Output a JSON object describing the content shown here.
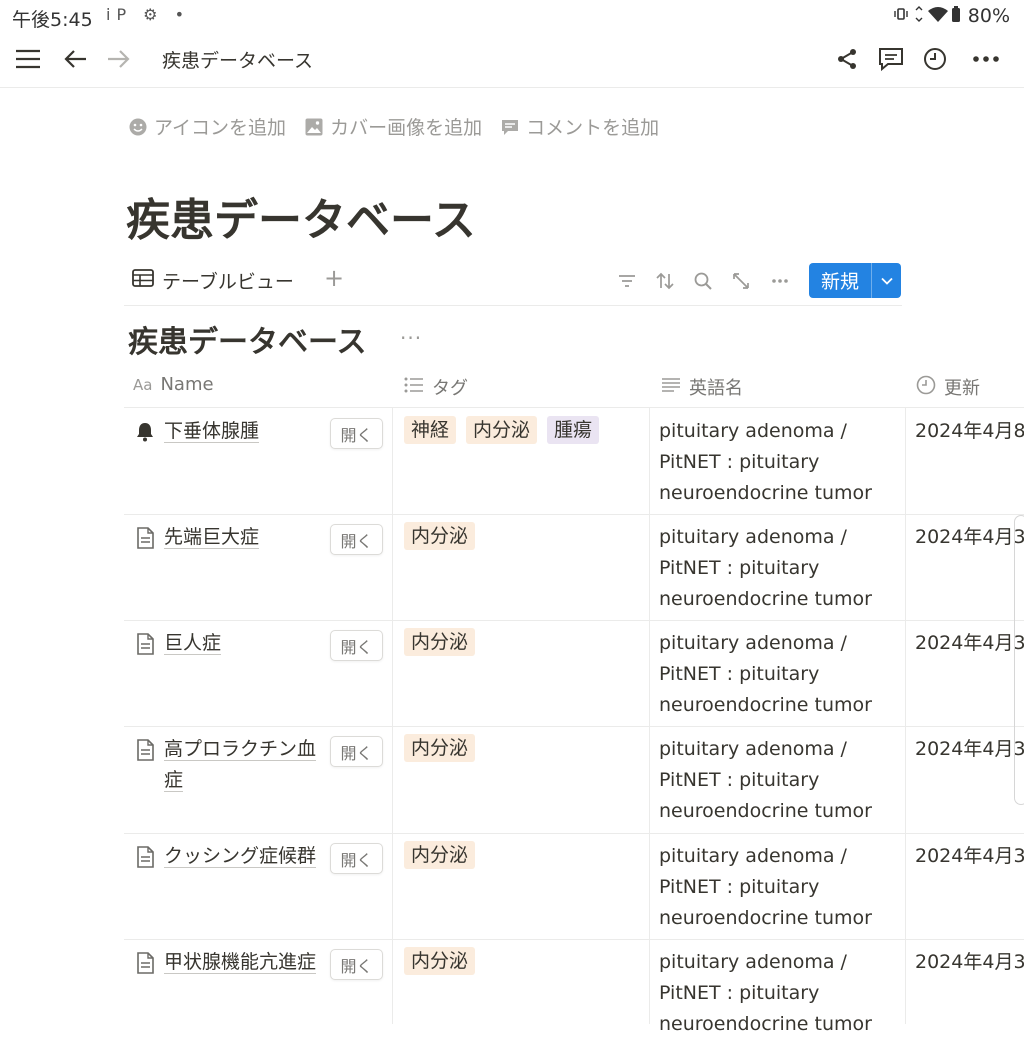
{
  "status_bar": {
    "time": "午後5:45",
    "notifications": "iP ⚙ •",
    "battery": "80%"
  },
  "top_bar": {
    "page_name": "疾患データベース"
  },
  "page_actions": {
    "add_icon": "アイコンを追加",
    "add_cover": "カバー画像を追加",
    "add_comment": "コメントを追加"
  },
  "page_title": "疾患データベース",
  "view_bar": {
    "tab_label": "テーブルビュー",
    "add_view": "+",
    "new_button": "新規"
  },
  "database": {
    "title": "疾患データベース",
    "more": "···",
    "columns": [
      {
        "label": "Name",
        "icon": "Aa"
      },
      {
        "label": "タグ",
        "icon": "list-icon"
      },
      {
        "label": "英語名",
        "icon": "text-icon"
      },
      {
        "label": "更新",
        "icon": "clock-icon"
      }
    ],
    "open_label": "開く",
    "rows": [
      {
        "icon": "bell-icon",
        "name": "下垂体腺腫",
        "tags": [
          "神経",
          "内分泌",
          "腫瘍"
        ],
        "english": "pituitary adenoma / PitNET : pituitary neuroendocrine tumor",
        "updated": "2024年4月8"
      },
      {
        "icon": "page-icon",
        "name": "先端巨大症",
        "tags": [
          "内分泌"
        ],
        "english": "pituitary adenoma / PitNET : pituitary neuroendocrine tumor",
        "updated": "2024年4月3"
      },
      {
        "icon": "page-icon",
        "name": "巨人症",
        "tags": [
          "内分泌"
        ],
        "english": "pituitary adenoma / PitNET : pituitary neuroendocrine tumor",
        "updated": "2024年4月3"
      },
      {
        "icon": "page-icon",
        "name": "高プロラクチン血症",
        "tags": [
          "内分泌"
        ],
        "english": "pituitary adenoma / PitNET : pituitary neuroendocrine tumor",
        "updated": "2024年4月3"
      },
      {
        "icon": "page-icon",
        "name": "クッシング症候群",
        "tags": [
          "内分泌"
        ],
        "english": "pituitary adenoma / PitNET : pituitary neuroendocrine tumor",
        "updated": "2024年4月3"
      },
      {
        "icon": "page-icon",
        "name": "甲状腺機能亢進症",
        "tags": [
          "内分泌"
        ],
        "english": "pituitary adenoma / PitNET : pituitary neuroendocrine tumor",
        "updated": "2024年4月3"
      }
    ]
  },
  "colors": {
    "accent": "#2383e2",
    "tag_orange_bg": "#fbecdd",
    "tag_purple_bg": "#eae4f2",
    "text": "#37352f",
    "muted": "#9b9a97"
  }
}
